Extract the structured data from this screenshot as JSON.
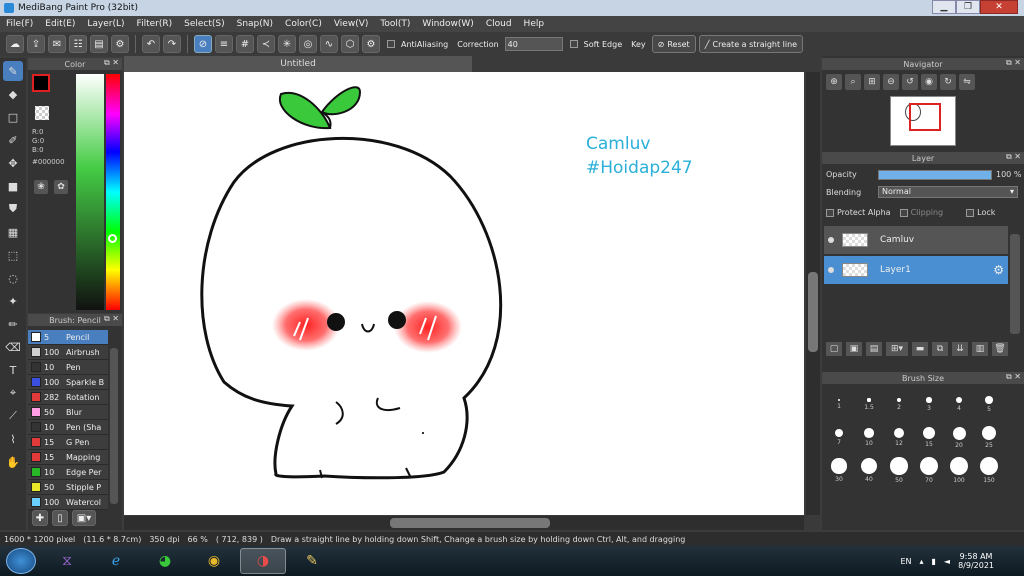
{
  "window": {
    "title": "MediBang Paint Pro (32bit)"
  },
  "menu": [
    "File(F)",
    "Edit(E)",
    "Layer(L)",
    "Filter(R)",
    "Select(S)",
    "Snap(N)",
    "Color(C)",
    "View(V)",
    "Tool(T)",
    "Window(W)",
    "Cloud",
    "Help"
  ],
  "toolbar": {
    "antialiasing_label": "AntiAliasing",
    "correction_label": "Correction",
    "correction_value": "40",
    "soft_edge_label": "Soft Edge",
    "key_label": "Key",
    "reset_label": "Reset",
    "straight_line_label": "Create a straight line"
  },
  "document": {
    "tab_title": "Untitled"
  },
  "color_panel": {
    "title": "Color",
    "r": "R:0",
    "g": "G:0",
    "b": "B:0",
    "hex": "#000000",
    "primary": "#000000",
    "secondary": "#ffffff"
  },
  "brush_panel": {
    "title": "Brush: Pencil",
    "items": [
      {
        "size": "5",
        "name": "Pencil",
        "color": "#ffffff"
      },
      {
        "size": "100",
        "name": "Airbrush",
        "color": "#cfcfcf"
      },
      {
        "size": "10",
        "name": "Pen",
        "color": "#333333"
      },
      {
        "size": "100",
        "name": "Sparkle B",
        "color": "#3a4fe0"
      },
      {
        "size": "282",
        "name": "Rotation",
        "color": "#e03a3a"
      },
      {
        "size": "50",
        "name": "Blur",
        "color": "#ff9ee5"
      },
      {
        "size": "10",
        "name": "Pen (Sha",
        "color": "#333333"
      },
      {
        "size": "15",
        "name": "G Pen",
        "color": "#e03a3a"
      },
      {
        "size": "15",
        "name": "Mapping",
        "color": "#e03a3a"
      },
      {
        "size": "10",
        "name": "Edge Per",
        "color": "#28b828"
      },
      {
        "size": "50",
        "name": "Stipple P",
        "color": "#e8e828"
      },
      {
        "size": "100",
        "name": "Watercol",
        "color": "#6ad0ff"
      }
    ]
  },
  "watermark": {
    "line1": "Camluv",
    "line2": "#Hoidap247"
  },
  "navigator": {
    "title": "Navigator"
  },
  "layer_panel": {
    "title": "Layer",
    "opacity_label": "Opacity",
    "opacity_value": "100 %",
    "opacity_fraction": 1.0,
    "blending_label": "Blending",
    "blending_value": "Normal",
    "protect_alpha_label": "Protect Alpha",
    "clipping_label": "Clipping",
    "lock_label": "Lock",
    "layers": [
      {
        "name": "Camluv",
        "selected": false
      },
      {
        "name": "Layer1",
        "selected": true
      }
    ]
  },
  "brush_size_panel": {
    "title": "Brush Size",
    "sizes": [
      "1",
      "1.5",
      "2",
      "3",
      "4",
      "5",
      "7",
      "10",
      "12",
      "15",
      "20",
      "25",
      "30",
      "40",
      "50",
      "70",
      "100",
      "150"
    ]
  },
  "status": {
    "pixels": "1600 * 1200 pixel",
    "physical": "(11.6 * 8.7cm)",
    "dpi": "350 dpi",
    "zoom": "66 %",
    "coords": "( 712, 839 )",
    "hint": "Draw a straight line by holding down Shift, Change a brush size by holding down Ctrl, Alt, and dragging"
  },
  "taskbar": {
    "lang": "EN",
    "time": "9:58 AM",
    "date": "8/9/2021"
  }
}
